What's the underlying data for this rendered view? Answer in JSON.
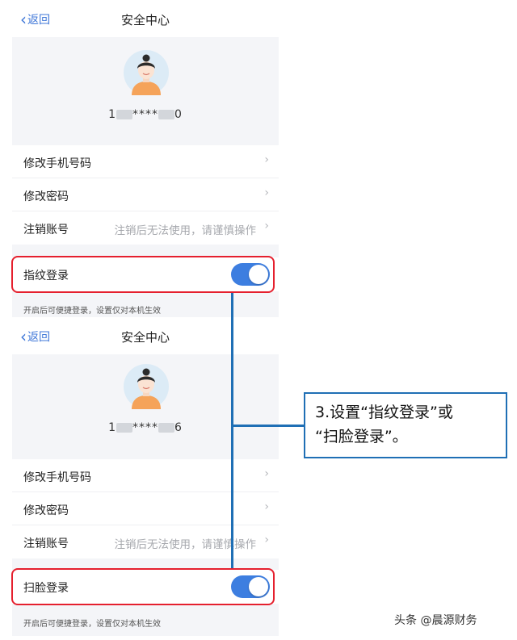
{
  "screens": [
    {
      "nav": {
        "back_label": "返回",
        "title": "安全中心"
      },
      "phone": {
        "prefix": "1",
        "middle": "****",
        "suffix": "0"
      },
      "menu": [
        {
          "label": "修改手机号码",
          "hint": ""
        },
        {
          "label": "修改密码",
          "hint": ""
        },
        {
          "label": "注销账号",
          "hint": "注销后无法使用，请谨慎操作"
        }
      ],
      "toggle": {
        "label": "指纹登录",
        "state": "on"
      },
      "note": "开启后可便捷登录，设置仅对本机生效"
    },
    {
      "nav": {
        "back_label": "返回",
        "title": "安全中心"
      },
      "phone": {
        "prefix": "1",
        "middle": "****",
        "suffix": "6"
      },
      "menu": [
        {
          "label": "修改手机号码",
          "hint": ""
        },
        {
          "label": "修改密码",
          "hint": ""
        },
        {
          "label": "注销账号",
          "hint": "注销后无法使用，请谨慎操作"
        }
      ],
      "toggle": {
        "label": "扫脸登录",
        "state": "on"
      },
      "note": "开启后可便捷登录，设置仅对本机生效"
    }
  ],
  "callout": {
    "line1": "3.设置“指纹登录”或",
    "line2": "“扫脸登录”。"
  },
  "watermark": "头条 @晨源财务",
  "colors": {
    "accent": "#3d7ee0",
    "highlight": "#e5202e",
    "connector": "#1f6fb5",
    "page_bg": "#f4f5f8"
  },
  "icons": {
    "back": "chevron-left-icon",
    "row_arrow": "chevron-right-icon",
    "avatar": "avatar-icon"
  }
}
